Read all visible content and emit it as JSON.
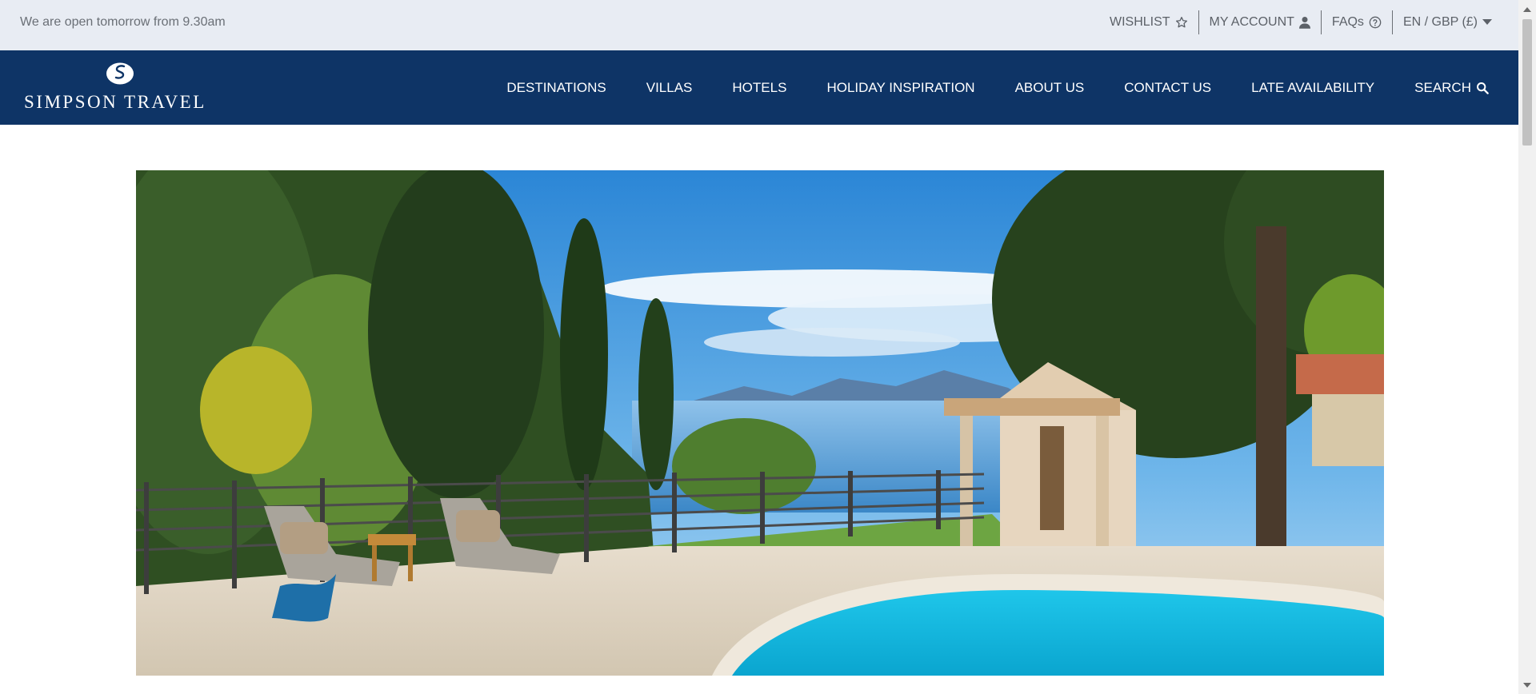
{
  "topbar": {
    "notice": "We are open tomorrow from 9.30am",
    "wishlist": "WISHLIST",
    "account": "MY ACCOUNT",
    "faqs": "FAQs",
    "locale": "EN / GBP (£)"
  },
  "brand": {
    "name": "SIMPSON TRAVEL"
  },
  "nav": {
    "items": [
      "DESTINATIONS",
      "VILLAS",
      "HOTELS",
      "HOLIDAY INSPIRATION",
      "ABOUT US",
      "CONTACT US",
      "LATE AVAILABILITY"
    ],
    "search": "SEARCH"
  },
  "icons": {
    "wishlist": "star-icon",
    "account": "user-icon",
    "faqs": "question-circle-icon",
    "locale": "caret-down-icon",
    "search": "search-icon"
  },
  "colors": {
    "navy": "#0e3466",
    "topbar_bg": "#e8ecf3"
  }
}
